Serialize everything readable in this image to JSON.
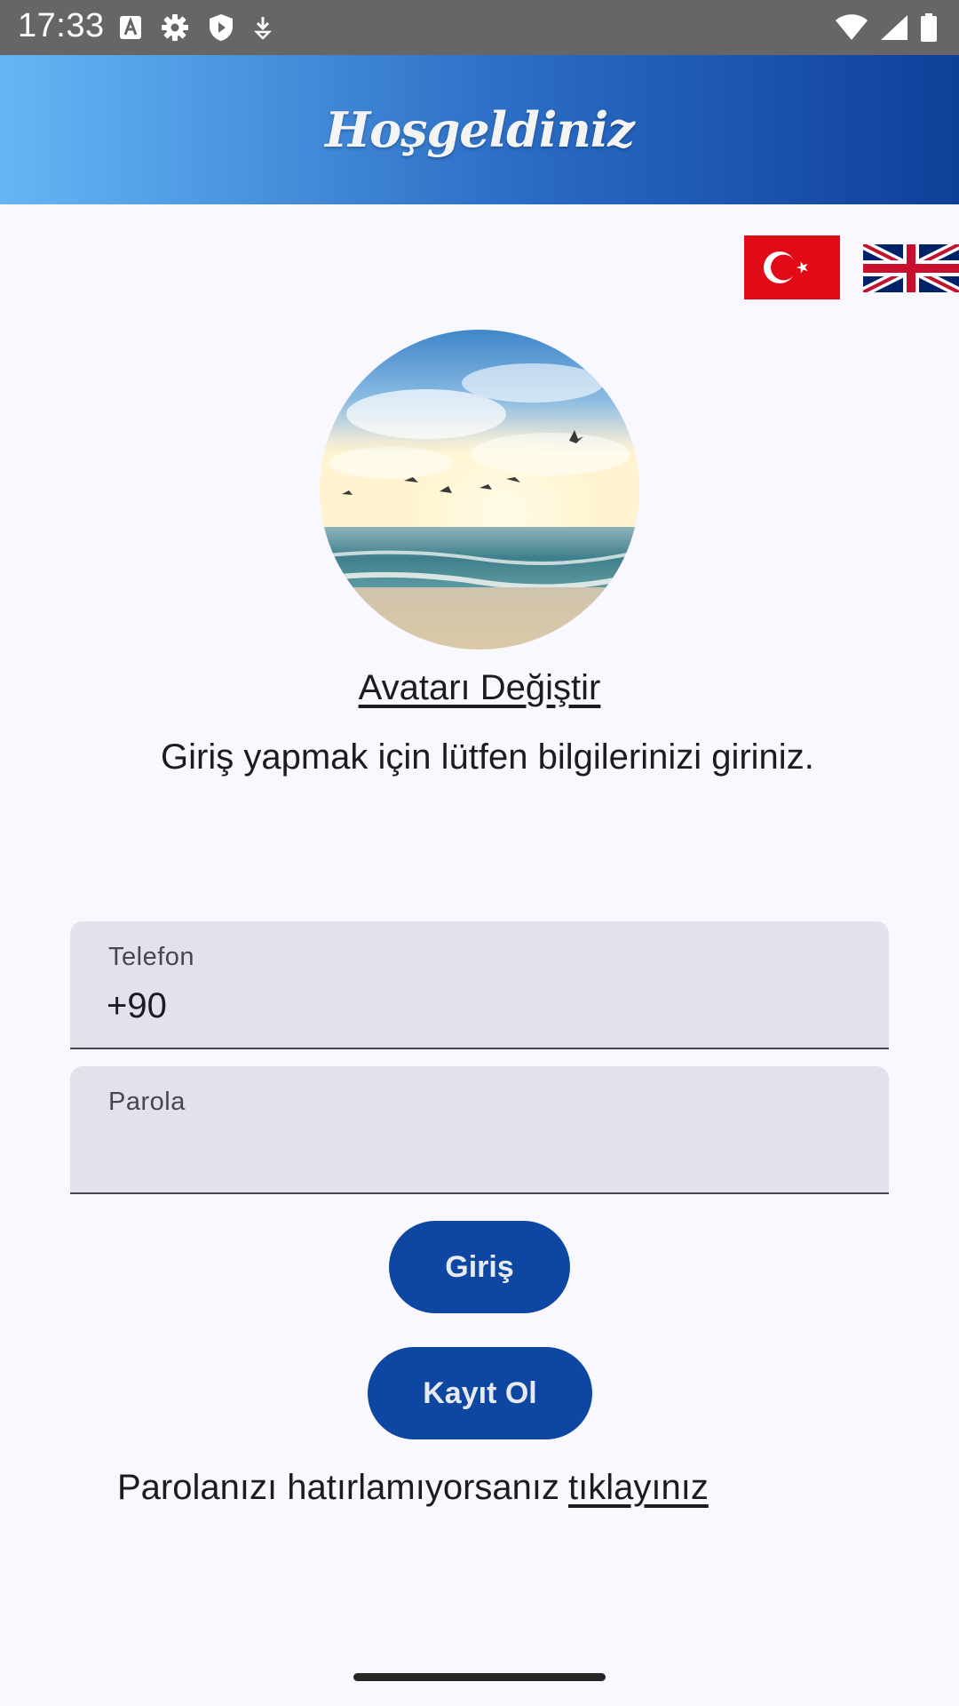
{
  "status_bar": {
    "time": "17:33",
    "icons": [
      "font-a-icon",
      "gear-icon",
      "shield-icon",
      "download-arrow-icon",
      "wifi-icon",
      "cellular-signal-icon",
      "battery-icon"
    ]
  },
  "header": {
    "title": "Hoşgeldiniz",
    "gradient": [
      "#65b6f5",
      "#0e3f99"
    ]
  },
  "language": {
    "flags": [
      "flag-turkey-icon",
      "flag-uk-icon"
    ]
  },
  "avatar": {
    "change_label": "Avatarı Değiştir"
  },
  "login": {
    "instructions": "Giriş yapmak için lütfen bilgilerinizi giriniz.",
    "phone_label": "Telefon",
    "phone_value": "+90",
    "password_label": "Parola",
    "password_value": "",
    "login_button": "Giriş",
    "register_button": "Kayıt Ol",
    "forgot_text": "Parolanızı hatırlamıyorsanız",
    "forgot_link": "tıklayınız"
  },
  "colors": {
    "primary": "#0d47a1",
    "background": "#f8f8fe",
    "field_fill": "#e3e1ec"
  }
}
